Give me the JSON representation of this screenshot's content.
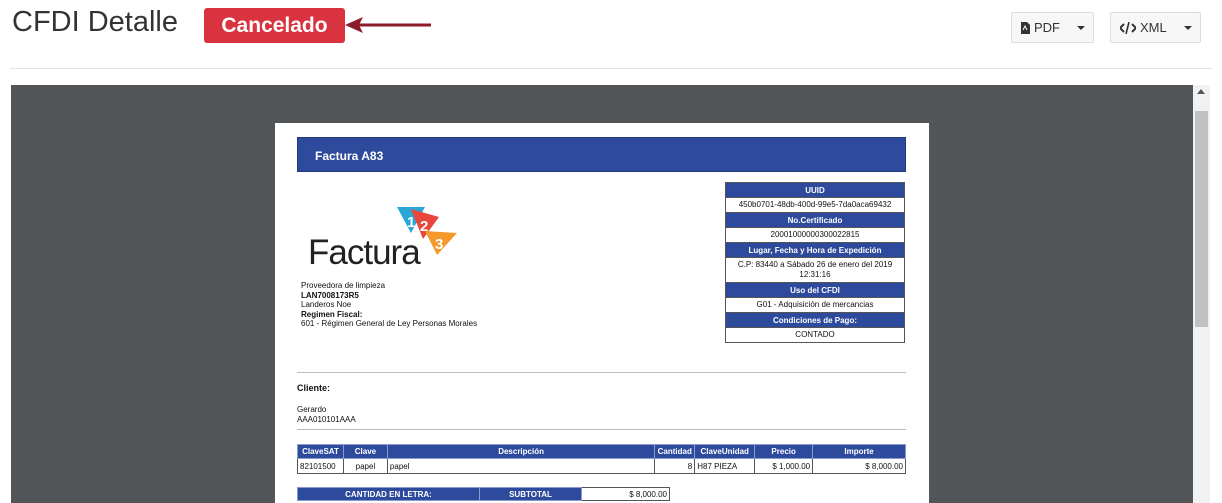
{
  "header": {
    "title": "CFDI Detalle",
    "status": "Cancelado",
    "pdf_label": "PDF",
    "xml_label": "XML"
  },
  "colors": {
    "status": "#d9333f",
    "accent": "#2e4a9d",
    "viewer_bg": "#525659",
    "arrow": "#8b1a2b"
  },
  "invoice": {
    "header_title": "Factura A83",
    "logo_text": "Factura",
    "logo_digits": [
      "1",
      "2",
      "3"
    ],
    "issuer": {
      "business": "Proveedora de limpieza",
      "rfc": "LAN7008173R5",
      "name": "Landeros Noe",
      "regime_label": "Regimen Fiscal:",
      "regime": "601 - Régimen General de Ley Personas Morales"
    },
    "info": [
      {
        "label": "UUID",
        "value": "450b0701-48db-400d-99e5-7da0aca69432"
      },
      {
        "label": "No.Certificado",
        "value": "20001000000300022815"
      },
      {
        "label": "Lugar, Fecha y Hora de Expedición",
        "value": "C.P: 83440 a Sábado 26 de enero del 2019",
        "value2": "12:31:16"
      },
      {
        "label": "Uso del CFDI",
        "value": "G01 - Adquisición de mercancias"
      },
      {
        "label": "Condiciones de Pago:",
        "value": "CONTADO"
      }
    ],
    "client": {
      "label": "Cliente:",
      "name": "Gerardo",
      "rfc": "AAA010101AAA"
    },
    "items_headers": [
      "ClaveSAT",
      "Clave",
      "Descripción",
      "Cantidad",
      "ClaveUnidad",
      "Precio",
      "Importe"
    ],
    "items": [
      {
        "clave_sat": "82101500",
        "clave": "papel",
        "descripcion": "papel",
        "cantidad": "8",
        "clave_unidad": "H87 PIEZA",
        "precio": "$ 1,000.00",
        "importe": "$ 8,000.00"
      }
    ],
    "totals": {
      "cantidad_letra_label": "CANTIDAD EN LETRA:",
      "subtotal_label": "SUBTOTAL",
      "subtotal": "$ 8,000.00"
    }
  }
}
